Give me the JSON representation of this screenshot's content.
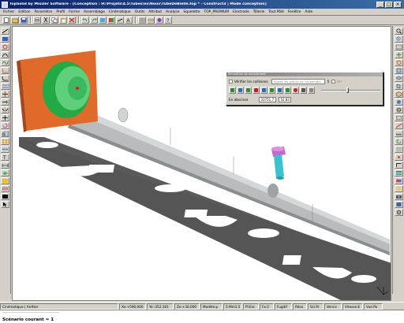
{
  "window": {
    "title": "TopSolid by Missler Software - [Conception : H:\\Projets\\4.5\\Tubes\\ex\\Nouv\\TubeDeBielle.top * - Construct3 | Mode conception]",
    "minimize": "_",
    "maximize": "□",
    "close": "×"
  },
  "menu": {
    "items": [
      "Fichier",
      "Edition",
      "Paramètre",
      "Profil",
      "Forme",
      "Assemblage",
      "Cinématique",
      "Outils",
      "Attribut",
      "Analyse",
      "Squelette",
      "TOP_PREMIUM",
      "Electrode",
      "Tôlerie",
      "Tout Pôlé",
      "Fenêtre",
      "Aide"
    ]
  },
  "colors": {
    "flange": "#e06a2a",
    "disc": "#22aa44",
    "disc_light": "#5ed07a",
    "tube": "#b8bcbc",
    "tube_dark": "#8a8e8e",
    "plate": "#555555",
    "tool_holder": "#c46ac8",
    "tool": "#39c2cf"
  },
  "icons": {
    "left_toolbar": [
      "line-icon",
      "rectangle-icon",
      "circle-icon",
      "arc-icon",
      "spline-icon",
      "fillet-icon",
      "chamfer-icon",
      "offset-icon",
      "trim-icon",
      "extend-icon",
      "mirror-icon",
      "move-icon",
      "rotate-icon",
      "scale-icon",
      "array-icon",
      "pattern-icon",
      "text-icon",
      "dimension-icon",
      "layer-icon",
      "color-icon",
      "erase-icon",
      "undo-icon",
      "redo-icon"
    ],
    "right_toolbar": [
      "zoom-in-icon",
      "zoom-out-icon",
      "zoom-window-icon",
      "pan-icon",
      "rotate-view-icon",
      "front-view-icon",
      "top-view-icon",
      "side-view-icon",
      "iso-view-icon",
      "shaded-icon",
      "wireframe-icon",
      "hidden-line-icon",
      "section-icon",
      "measure-icon",
      "refresh-icon",
      "grid-icon",
      "snap-icon",
      "ortho-icon",
      "layer-view-icon",
      "color-view-icon",
      "light-icon",
      "camera-icon",
      "save-view-icon",
      "settings-icon"
    ]
  },
  "sim_panel": {
    "title": "Simulation de mouvement",
    "check_label": "Vérifier les collisions",
    "select_placeholder": "Toutes les pièces de l'ensemble",
    "option_label": "Arr",
    "option_value": "5",
    "position_label": "En abscisse",
    "value1": "33751,7",
    "value2": "52,83",
    "slider_fraction": 0.45
  },
  "status": {
    "cells": [
      "Cinématique | Arrêter",
      "Xe:+590,000",
      "Ye:-352,101",
      "Ze:+30,000",
      "Modèle:p",
      "5:Mm1.5",
      "Pl:Esc",
      "Fx:2",
      "Fugitif",
      "Résa",
      "Sci:Pr",
      "Vernis",
      "Vitesse:E",
      "Vue:Pa"
    ]
  },
  "command": {
    "dashes": "--------------------------------------------",
    "scenario_label": "Scénario courant = 1"
  }
}
